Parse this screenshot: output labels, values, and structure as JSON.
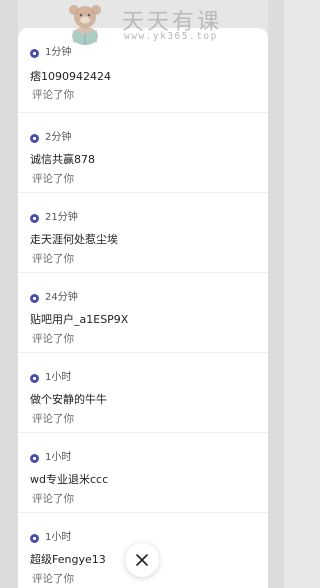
{
  "notifications": [
    {
      "time": "1分钟",
      "user": "痞1090942424",
      "action": "评论了你"
    },
    {
      "time": "2分钟",
      "user": "诚信共赢878",
      "action": "评论了你"
    },
    {
      "time": "21分钟",
      "user": "走天涯何处惹尘埃",
      "action": "评论了你"
    },
    {
      "time": "24分钟",
      "user": "贴吧用户_a1ESP9X",
      "action": "评论了你"
    },
    {
      "time": "1小时",
      "user": "做个安静的牛牛",
      "action": "评论了你"
    },
    {
      "time": "1小时",
      "user": "wd专业退米ccc",
      "action": "评论了你"
    },
    {
      "time": "1小时",
      "user": "超级Fengye13",
      "action": "评论了你"
    }
  ],
  "watermark": {
    "title": "天天有课",
    "url": "www.yk365.top"
  },
  "icons": {
    "badge": "tieba-badge-icon",
    "close": "close-icon"
  },
  "colors": {
    "badge": "#4a4fa8",
    "panel": "#ffffff",
    "background": "#e6e6e6"
  }
}
